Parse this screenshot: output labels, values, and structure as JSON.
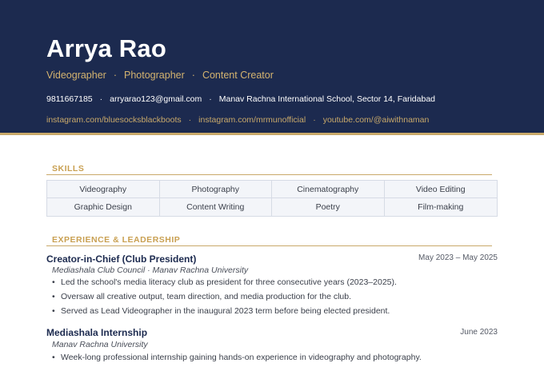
{
  "header": {
    "name": "Arrya Rao",
    "roles": [
      "Videographer",
      "Photographer",
      "Content Creator"
    ],
    "contact": [
      "9811667185",
      "arryarao123@gmail.com",
      "Manav Rachna International School, Sector 14, Faridabad"
    ],
    "links": [
      "instagram.com/bluesocksblackboots",
      "instagram.com/mrmunofficial",
      "youtube.com/@aiwithnaman"
    ],
    "separator": "·"
  },
  "skills": {
    "title": "SKILLS",
    "items": [
      "Videography",
      "Photography",
      "Cinematography",
      "Video Editing",
      "Graphic Design",
      "Content Writing",
      "Poetry",
      "Film-making"
    ]
  },
  "experience": {
    "title": "EXPERIENCE & LEADERSHIP",
    "jobs": [
      {
        "title": "Creator-in-Chief (Club President)",
        "org": "Mediashala Club Council · Manav Rachna University",
        "date": "May 2023 – May 2025",
        "bullets": [
          "Led the school's media literacy club as president for three consecutive years (2023–2025).",
          "Oversaw all creative output, team direction, and media production for the club.",
          "Served as Lead Videographer in the inaugural 2023 term before being elected president."
        ]
      },
      {
        "title": "Mediashala Internship",
        "org": "Manav Rachna University",
        "date": "June 2023",
        "bullets": [
          "Week-long professional internship gaining hands-on experience in videography and photography."
        ]
      }
    ]
  },
  "colors": {
    "header_bg": "#1c2a4f",
    "accent_gold": "#c9a96a",
    "section_gold": "#c9a052",
    "title_navy": "#1c2a4f"
  }
}
